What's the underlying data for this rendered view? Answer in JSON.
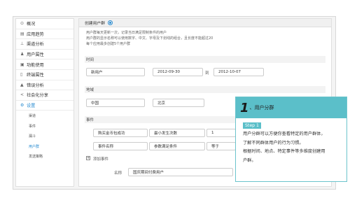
{
  "sidebar": {
    "items": [
      {
        "icon": "⊙",
        "label": "概况"
      },
      {
        "icon": "▤",
        "label": "应用趋势"
      },
      {
        "icon": "⊥",
        "label": "渠道分析"
      },
      {
        "icon": "♟",
        "label": "用户属性"
      },
      {
        "icon": "▣",
        "label": "功能使用"
      },
      {
        "icon": "▯",
        "label": "终端属性"
      },
      {
        "icon": "▲",
        "label": "错误分析"
      },
      {
        "icon": "<",
        "label": "社会化分享"
      },
      {
        "icon": "⚙",
        "label": "设置"
      }
    ],
    "sub_items": [
      "渠道",
      "事件",
      "漏斗",
      "用户群",
      "发送策略"
    ],
    "active_sub": "用户群"
  },
  "main": {
    "title": "创建用户群",
    "intro": [
      "用户群每天更新一次，记录当日满足限制条件的用户",
      "用户群的显示名称可以使用数字、中文、字母及下划线的组合，且长度不能超过20",
      "每个应用最多创建5个用户群"
    ],
    "time": {
      "label": "时间",
      "user_type": "新用户",
      "start": "2012-09-30",
      "to": "到",
      "end": "2012-10-07"
    },
    "region": {
      "label": "地域",
      "country": "中国",
      "city": "北京"
    },
    "event": {
      "label": "事件",
      "row1": {
        "name": "购买金币包成功",
        "cond": "最小发生次数",
        "val": "1"
      },
      "row2": {
        "name": "事件名称",
        "cond": "参数满足条件",
        "op": "等于"
      },
      "add": "添加事件"
    },
    "name": {
      "label": "名称",
      "value": "国庆期间付费用户"
    }
  },
  "tip": {
    "number": "1",
    "title": "、用户分群",
    "step": "Step 1",
    "text": [
      "用户分群可以方便你查看特定的用户群体，",
      "了解不同群体用户的行为习惯。",
      "根据时间、地点、特定事件等多维度创建用",
      "户群。"
    ]
  },
  "colors": {
    "accent": "#2a8cd1",
    "tip": "#5bbfc9"
  }
}
